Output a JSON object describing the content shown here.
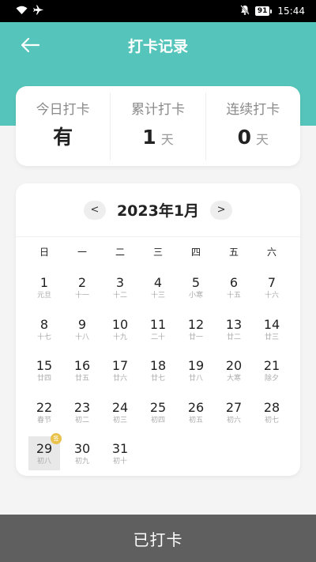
{
  "status_bar": {
    "time": "15:44",
    "battery": "91",
    "icons": [
      "wifi-icon",
      "airplane-icon",
      "mute-icon",
      "battery-icon"
    ]
  },
  "header": {
    "title": "打卡记录",
    "back_icon": "arrow-left-icon",
    "bg_color": "#55c4ba"
  },
  "stats": {
    "today": {
      "label": "今日打卡",
      "value": "有"
    },
    "total": {
      "label": "累计打卡",
      "value": "1",
      "unit": "天"
    },
    "streak": {
      "label": "连续打卡",
      "value": "0",
      "unit": "天"
    }
  },
  "calendar": {
    "prev": "<",
    "next": ">",
    "month_title": "2023年1月",
    "weekdays": [
      "日",
      "一",
      "二",
      "三",
      "四",
      "五",
      "六"
    ],
    "badge": "签",
    "days": [
      {
        "day": "1",
        "lunar": "元旦"
      },
      {
        "day": "2",
        "lunar": "十一"
      },
      {
        "day": "3",
        "lunar": "十二"
      },
      {
        "day": "4",
        "lunar": "十三"
      },
      {
        "day": "5",
        "lunar": "小寒"
      },
      {
        "day": "6",
        "lunar": "十五"
      },
      {
        "day": "7",
        "lunar": "十六"
      },
      {
        "day": "8",
        "lunar": "十七"
      },
      {
        "day": "9",
        "lunar": "十八"
      },
      {
        "day": "10",
        "lunar": "十九"
      },
      {
        "day": "11",
        "lunar": "二十"
      },
      {
        "day": "12",
        "lunar": "廿一"
      },
      {
        "day": "13",
        "lunar": "廿二"
      },
      {
        "day": "14",
        "lunar": "廿三"
      },
      {
        "day": "15",
        "lunar": "廿四"
      },
      {
        "day": "16",
        "lunar": "廿五"
      },
      {
        "day": "17",
        "lunar": "廿六"
      },
      {
        "day": "18",
        "lunar": "廿七"
      },
      {
        "day": "19",
        "lunar": "廿八"
      },
      {
        "day": "20",
        "lunar": "大寒"
      },
      {
        "day": "21",
        "lunar": "除夕"
      },
      {
        "day": "22",
        "lunar": "春节"
      },
      {
        "day": "23",
        "lunar": "初二"
      },
      {
        "day": "24",
        "lunar": "初三"
      },
      {
        "day": "25",
        "lunar": "初四"
      },
      {
        "day": "26",
        "lunar": "初五"
      },
      {
        "day": "27",
        "lunar": "初六"
      },
      {
        "day": "28",
        "lunar": "初七"
      },
      {
        "day": "29",
        "lunar": "初八",
        "today": true,
        "checked": true
      },
      {
        "day": "30",
        "lunar": "初九"
      },
      {
        "day": "31",
        "lunar": "初十"
      }
    ]
  },
  "action": {
    "label": "已打卡"
  }
}
